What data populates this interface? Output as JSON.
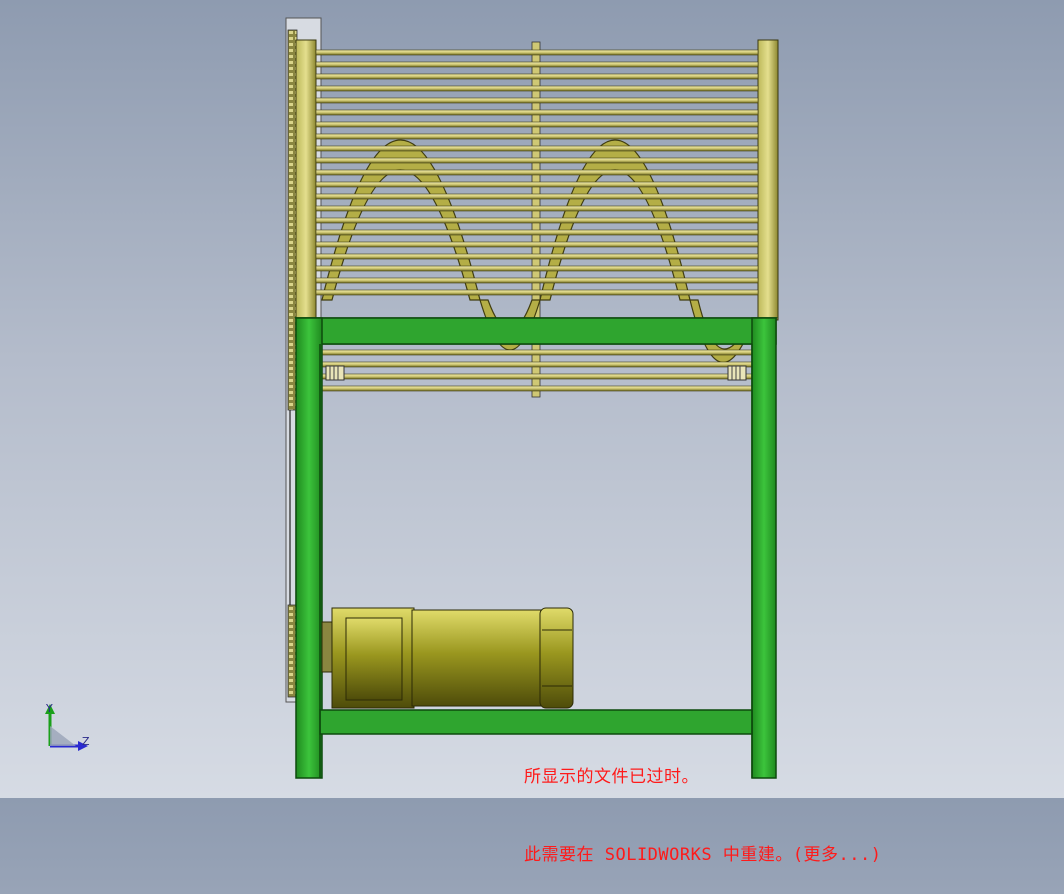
{
  "model_view": {
    "status_message": {
      "line1": "所显示的文件已过时。",
      "line2": "此需要在 SOLIDWORKS 中重建。(更多...)"
    },
    "triad": {
      "x_label": "Z",
      "y_label": "Y"
    },
    "colors": {
      "frame_green": "#2fa52f",
      "frame_dark": "#0d4a0d",
      "brass": "#c8c26a",
      "brass_dark": "#6e6a20",
      "motor": "#8d8a1e",
      "message_red": "#ff1a1a"
    }
  }
}
